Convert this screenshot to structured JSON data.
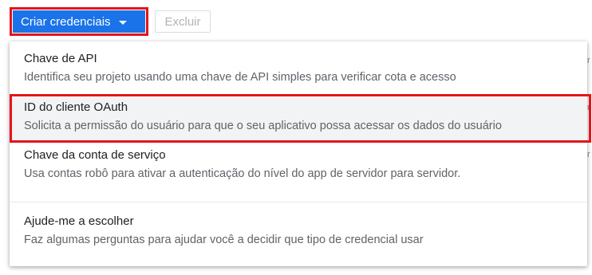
{
  "toolbar": {
    "create_credentials_label": "Criar credenciais",
    "delete_label": "Excluir"
  },
  "menu": {
    "items": [
      {
        "title": "Chave de API",
        "description": "Identifica seu projeto usando uma chave de API simples para verificar cota e acesso"
      },
      {
        "title": "ID do cliente OAuth",
        "description": "Solicita a permissão do usuário para que o seu aplicativo possa acessar os dados do usuário"
      },
      {
        "title": "Chave da conta de serviço",
        "description": "Usa contas robô para ativar a autenticação do nível do app de servidor para servidor."
      },
      {
        "title": "Ajude-me a escolher",
        "description": "Faz algumas perguntas para ajudar você a decidir que tipo de credencial usar"
      }
    ]
  },
  "colors": {
    "primary": "#1a73e8",
    "highlight": "#e5141b",
    "hover_background": "#f1f3f4"
  }
}
